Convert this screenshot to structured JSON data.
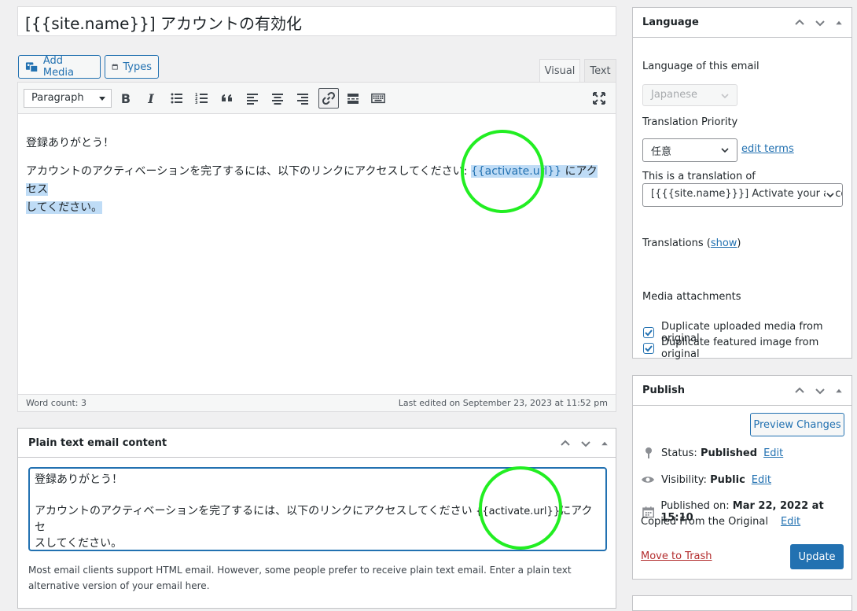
{
  "title": {
    "value": "[{{site.name}}] アカウントの有効化"
  },
  "media_buttons": {
    "add_media": "Add Media",
    "types": "Types"
  },
  "editor_tabs": {
    "visual": "Visual",
    "text": "Text"
  },
  "toolbar": {
    "format": "Paragraph",
    "bold": "B",
    "italic": "I"
  },
  "editor": {
    "line1": "登録ありがとう！",
    "line2_a": "アカウントのアクティベーションを完了するには、以下のリンクにアクセスしてください: ",
    "line2_url": "{{activate.url}}",
    "line2_b": " にアクセス",
    "line2_c": "してください。"
  },
  "status_bar": {
    "word_count": "Word count: 3",
    "last_edited": "Last edited on September 23, 2023 at 11:52 pm"
  },
  "plain_text_box": {
    "title": "Plain text email content",
    "line1": "登録ありがとう！",
    "line2_a": "アカウントのアクティベーションを完了するには、以下のリンクにアクセスしてください  ",
    "line2_url": "{{activate.url}}",
    "line2_b": "にアクセ",
    "line2_c": "スしてください。",
    "note": "Most email clients support HTML email. However, some people prefer to receive plain text email. Enter a plain text alternative version of your email here."
  },
  "language_box": {
    "title": "Language",
    "language_label": "Language of this email",
    "language_value": "Japanese",
    "priority_label": "Translation Priority",
    "priority_value": "任意",
    "edit_terms": "edit terms",
    "translation_of_label": "This is a translation of",
    "translation_of_value": "[{{{site.name}}}] Activate your account",
    "translations_label": "Translations (",
    "translations_show": "show",
    "translations_close": ")",
    "media_label": "Media attachments",
    "dup_media": "Duplicate uploaded media from original",
    "dup_featured": "Duplicate featured image from original"
  },
  "publish_box": {
    "title": "Publish",
    "preview": "Preview Changes",
    "status_label": "Status: ",
    "status_value": "Published",
    "visibility_label": "Visibility: ",
    "visibility_value": "Public",
    "published_label": "Published on: ",
    "published_value": "Mar 22, 2022 at 15:10",
    "copied": "Copied From the Original",
    "edit": "Edit",
    "trash": "Move to Trash",
    "update": "Update"
  },
  "colors": {
    "accent": "#2271b1",
    "annotation": "#22ee22",
    "selection": "#bfdcf6"
  }
}
